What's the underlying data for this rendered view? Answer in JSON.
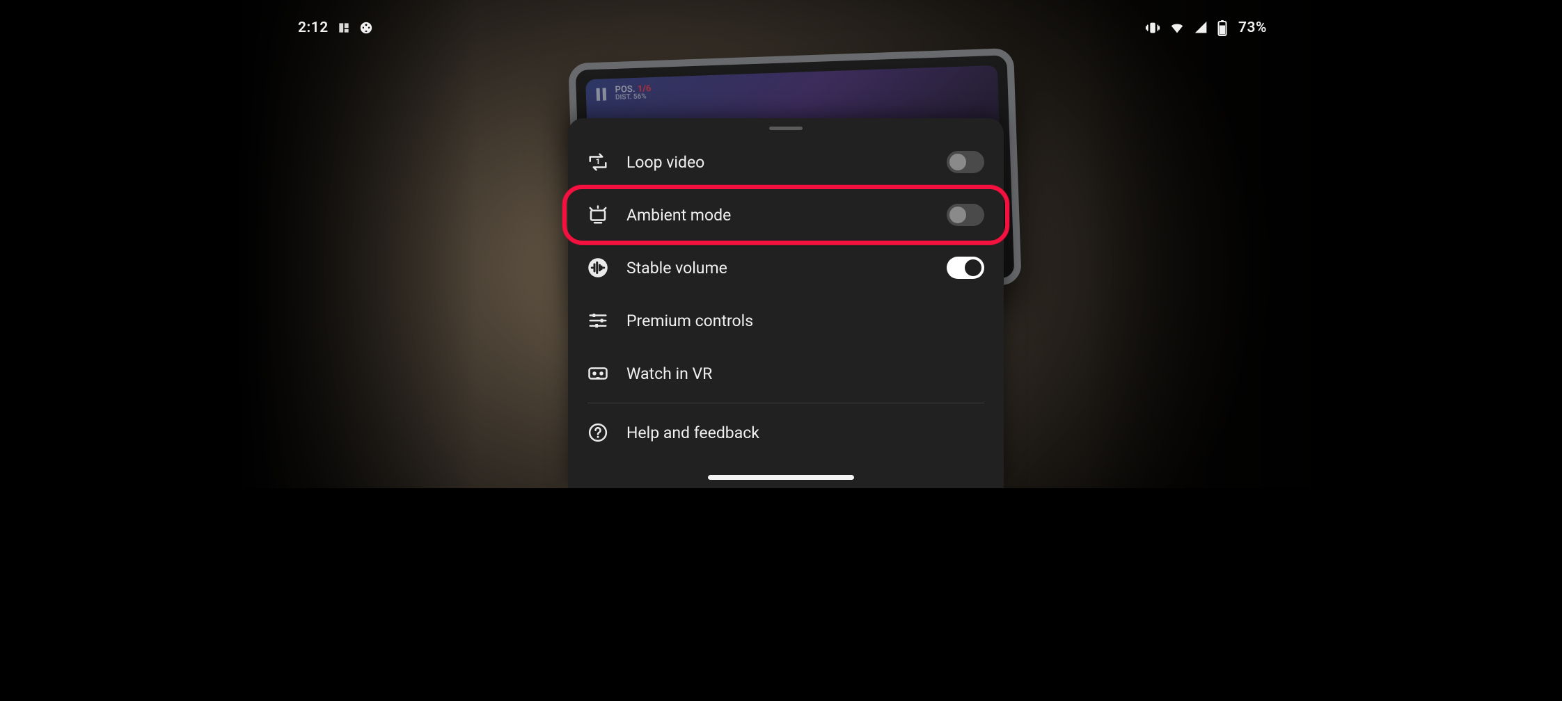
{
  "status": {
    "clock": "2:12",
    "battery_pct": "73%"
  },
  "bg_hud": {
    "pos_label": "POS.",
    "pos_value": "1/6",
    "dist_label": "DIST.",
    "dist_value": "56%"
  },
  "highlight_index": 1,
  "menu": [
    {
      "id": "loop-video",
      "label": "Loop video",
      "icon": "loop-icon",
      "toggle": false
    },
    {
      "id": "ambient-mode",
      "label": "Ambient mode",
      "icon": "ambient-icon",
      "toggle": false
    },
    {
      "id": "stable-volume",
      "label": "Stable volume",
      "icon": "volume-icon",
      "toggle": true
    },
    {
      "id": "premium-controls",
      "label": "Premium controls",
      "icon": "sliders-icon",
      "toggle": null
    },
    {
      "id": "watch-in-vr",
      "label": "Watch in VR",
      "icon": "vr-icon",
      "toggle": null
    },
    {
      "id": "help-feedback",
      "label": "Help and feedback",
      "icon": "help-icon",
      "toggle": null,
      "divider_before": true
    }
  ]
}
